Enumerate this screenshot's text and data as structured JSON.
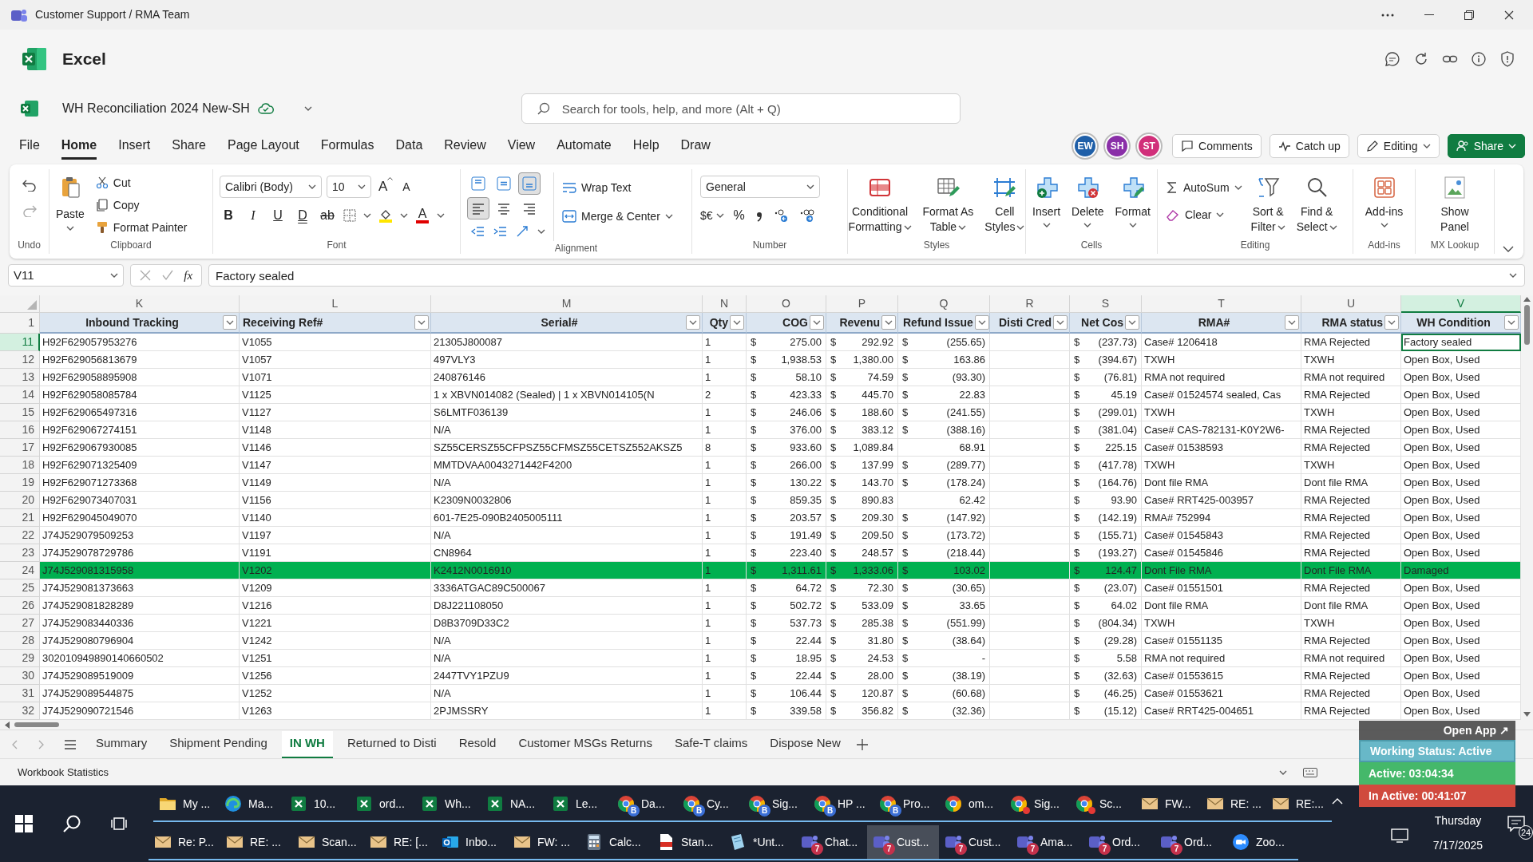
{
  "window": {
    "title": "Customer Support / RMA Team"
  },
  "app": {
    "name": "Excel"
  },
  "document": {
    "name": "WH Reconciliation 2024 New-SH"
  },
  "search": {
    "placeholder": "Search for tools, help, and more (Alt + Q)"
  },
  "tabs": [
    {
      "label": "File",
      "selected": false
    },
    {
      "label": "Home",
      "selected": true
    },
    {
      "label": "Insert",
      "selected": false
    },
    {
      "label": "Share",
      "selected": false
    },
    {
      "label": "Page Layout",
      "selected": false
    },
    {
      "label": "Formulas",
      "selected": false
    },
    {
      "label": "Data",
      "selected": false
    },
    {
      "label": "Review",
      "selected": false
    },
    {
      "label": "View",
      "selected": false
    },
    {
      "label": "Automate",
      "selected": false
    },
    {
      "label": "Help",
      "selected": false
    },
    {
      "label": "Draw",
      "selected": false
    }
  ],
  "avatars": [
    {
      "initials": "EW",
      "color": "#1f5fa8"
    },
    {
      "initials": "SH",
      "color": "#8a2fa8"
    },
    {
      "initials": "ST",
      "color": "#d12f7a"
    }
  ],
  "actions": [
    {
      "kind": "comments",
      "label": "Comments"
    },
    {
      "kind": "catchup",
      "label": "Catch up"
    },
    {
      "kind": "editing",
      "label": "Editing"
    },
    {
      "kind": "share",
      "label": "Share"
    }
  ],
  "ribbon": [
    {
      "kind": "undo",
      "label": "Undo"
    },
    {
      "kind": "clipboard",
      "label": "Clipboard",
      "paste": "Paste",
      "items": [
        "Cut",
        "Copy",
        "Format Painter"
      ]
    },
    {
      "kind": "font",
      "label": "Font",
      "font": "Calibri (Body)",
      "size": "10",
      "grow": "A",
      "shrink": "A",
      "styles": [
        "B",
        "I",
        "U",
        "D",
        "ab"
      ],
      "color_letter": "A"
    },
    {
      "kind": "alignment",
      "label": "Alignment",
      "align": [
        {
          "selected": false
        },
        {
          "selected": false
        },
        {
          "selected": true
        },
        {
          "selected": true
        },
        {
          "selected": false
        },
        {
          "selected": false
        }
      ],
      "wrap": "Wrap Text",
      "merge": "Merge & Center"
    },
    {
      "kind": "number",
      "label": "Number",
      "format": "General",
      "currency": "$€",
      "percent": "%"
    },
    {
      "kind": "large",
      "label": "Styles",
      "buttons": [
        {
          "lines": [
            "Conditional",
            "Formatting"
          ],
          "dropdown": true
        },
        {
          "lines": [
            "Format As",
            "Table"
          ],
          "dropdown": true
        },
        {
          "lines": [
            "Cell",
            "Styles"
          ],
          "dropdown": true
        }
      ]
    },
    {
      "kind": "large",
      "label": "Cells",
      "buttons": [
        {
          "lines": [
            "Insert"
          ],
          "dropdown": true
        },
        {
          "lines": [
            "Delete"
          ],
          "dropdown": true
        },
        {
          "lines": [
            "Format"
          ],
          "dropdown": true
        }
      ]
    },
    {
      "kind": "editing",
      "label": "Editing",
      "small": [
        "AutoSum",
        "Clear"
      ],
      "buttons": [
        {
          "lines": [
            "Sort &",
            "Filter"
          ],
          "dropdown": true
        },
        {
          "lines": [
            "Find &",
            "Select"
          ],
          "dropdown": true
        }
      ]
    },
    {
      "kind": "large",
      "label": "Add-ins",
      "buttons": [
        {
          "lines": [
            "Add-ins"
          ],
          "dropdown": true
        }
      ]
    },
    {
      "kind": "large",
      "label": "MX Lookup",
      "buttons": [
        {
          "lines": [
            "Show",
            "Panel"
          ],
          "dropdown": false
        }
      ]
    }
  ],
  "formula_bar": {
    "cell": "V11",
    "function_button": "fx",
    "value": "Factory sealed"
  },
  "header_row_number": "1",
  "columns": [
    {
      "letter": "K",
      "header": "Inbound Tracking",
      "kind": "text",
      "selected": false
    },
    {
      "letter": "L",
      "header": "Receiving Ref#",
      "kind": "text",
      "selected": false
    },
    {
      "letter": "M",
      "header": "Serial#",
      "kind": "text",
      "selected": false
    },
    {
      "letter": "N",
      "header": "Qty",
      "kind": "text",
      "selected": false
    },
    {
      "letter": "O",
      "header": "COG",
      "kind": "money",
      "selected": false
    },
    {
      "letter": "P",
      "header": "Revenu",
      "kind": "money",
      "selected": false
    },
    {
      "letter": "Q",
      "header": "Refund Issue",
      "kind": "money",
      "selected": false
    },
    {
      "letter": "R",
      "header": "Disti Cred",
      "kind": "blank",
      "selected": false
    },
    {
      "letter": "S",
      "header": "Net Cos",
      "kind": "money",
      "selected": false
    },
    {
      "letter": "T",
      "header": "RMA#",
      "kind": "text",
      "selected": false
    },
    {
      "letter": "U",
      "header": "RMA status",
      "kind": "text",
      "selected": false
    },
    {
      "letter": "V",
      "header": "WH Condition",
      "kind": "text",
      "selected": true
    }
  ],
  "rows": [
    {
      "number": "11",
      "active": true,
      "highlighted": false,
      "cells": [
        "H92F629057953276",
        "V1055",
        "21305J800087",
        "1",
        {
          "symbol": "$",
          "amount": "275.00"
        },
        {
          "symbol": "$",
          "amount": "292.92"
        },
        {
          "symbol": "$",
          "amount": "(255.65)"
        },
        {
          "symbol": "$",
          "amount": "(237.73)"
        },
        "Case# 1206418",
        "RMA Rejected",
        "Factory sealed"
      ]
    },
    {
      "number": "12",
      "active": false,
      "highlighted": false,
      "cells": [
        "H92F629056813679",
        "V1057",
        "497VLY3",
        "1",
        {
          "symbol": "$",
          "amount": "1,938.53"
        },
        {
          "symbol": "$",
          "amount": "1,380.00"
        },
        {
          "symbol": "$",
          "amount": "163.86"
        },
        {
          "symbol": "$",
          "amount": "(394.67)"
        },
        "TXWH",
        "TXWH",
        "Open Box, Used"
      ]
    },
    {
      "number": "13",
      "active": false,
      "highlighted": false,
      "cells": [
        "H92F629058895908",
        "V1071",
        "240876146",
        "1",
        {
          "symbol": "$",
          "amount": "58.10"
        },
        {
          "symbol": "$",
          "amount": "74.59"
        },
        {
          "symbol": "$",
          "amount": "(93.30)"
        },
        {
          "symbol": "$",
          "amount": "(76.81)"
        },
        "RMA not required",
        "RMA not required",
        "Open Box, Used"
      ]
    },
    {
      "number": "14",
      "active": false,
      "highlighted": false,
      "cells": [
        "H92F629058085784",
        "V1125",
        "1 x XBVN014082 (Sealed) | 1 x XBVN014105(N",
        "2",
        {
          "symbol": "$",
          "amount": "423.33"
        },
        {
          "symbol": "$",
          "amount": "445.70"
        },
        {
          "symbol": "$",
          "amount": "22.83"
        },
        {
          "symbol": "$",
          "amount": "45.19"
        },
        "Case# 01524574 sealed, Cas",
        "RMA Rejected",
        "Open Box, Used"
      ]
    },
    {
      "number": "15",
      "active": false,
      "highlighted": false,
      "cells": [
        "H92F629065497316",
        "V1127",
        "S6LMTF036139",
        "1",
        {
          "symbol": "$",
          "amount": "246.06"
        },
        {
          "symbol": "$",
          "amount": "188.60"
        },
        {
          "symbol": "$",
          "amount": "(241.55)"
        },
        {
          "symbol": "$",
          "amount": "(299.01)"
        },
        "TXWH",
        "TXWH",
        "Open Box, Used"
      ]
    },
    {
      "number": "16",
      "active": false,
      "highlighted": false,
      "cells": [
        "H92F629067274151",
        "V1148",
        "N/A",
        "1",
        {
          "symbol": "$",
          "amount": "376.00"
        },
        {
          "symbol": "$",
          "amount": "383.12"
        },
        {
          "symbol": "$",
          "amount": "(388.16)"
        },
        {
          "symbol": "$",
          "amount": "(381.04)"
        },
        "Case# CAS-782131-K0Y2W6-",
        "RMA Rejected",
        "Open Box, Used"
      ]
    },
    {
      "number": "17",
      "active": false,
      "highlighted": false,
      "cells": [
        "H92F629067930085",
        "V1146",
        "SZ55CERSZ55CFPSZ55CFMSZ55CETSZ552AKSZ5",
        "8",
        {
          "symbol": "$",
          "amount": "933.60"
        },
        {
          "symbol": "$",
          "amount": "1,089.84"
        },
        {
          "amount": "68.91"
        },
        {
          "symbol": "$",
          "amount": "225.15"
        },
        "Case# 01538593",
        "RMA Rejected",
        "Open Box, Used"
      ]
    },
    {
      "number": "18",
      "active": false,
      "highlighted": false,
      "cells": [
        "H92F629071325409",
        "V1147",
        "MMTDVAA0043271442F4200",
        "1",
        {
          "symbol": "$",
          "amount": "266.00"
        },
        {
          "symbol": "$",
          "amount": "137.99"
        },
        {
          "symbol": "$",
          "amount": "(289.77)"
        },
        {
          "symbol": "$",
          "amount": "(417.78)"
        },
        "TXWH",
        "TXWH",
        "Open Box, Used"
      ]
    },
    {
      "number": "19",
      "active": false,
      "highlighted": false,
      "cells": [
        "H92F629071273368",
        "V1149",
        "N/A",
        "1",
        {
          "symbol": "$",
          "amount": "130.22"
        },
        {
          "symbol": "$",
          "amount": "143.70"
        },
        {
          "symbol": "$",
          "amount": "(178.24)"
        },
        {
          "symbol": "$",
          "amount": "(164.76)"
        },
        "Dont file RMA",
        "Dont file RMA",
        "Open Box, Used"
      ]
    },
    {
      "number": "20",
      "active": false,
      "highlighted": false,
      "cells": [
        "H92F629073407031",
        "V1156",
        "K2309N0032806",
        "1",
        {
          "symbol": "$",
          "amount": "859.35"
        },
        {
          "symbol": "$",
          "amount": "890.83"
        },
        {
          "amount": "62.42"
        },
        {
          "symbol": "$",
          "amount": "93.90"
        },
        "Case# RRT425-003957",
        "RMA Rejected",
        "Open Box, Used"
      ]
    },
    {
      "number": "21",
      "active": false,
      "highlighted": false,
      "cells": [
        "H92F629045049070",
        "V1140",
        "601-7E25-090B2405005111",
        "1",
        {
          "symbol": "$",
          "amount": "203.57"
        },
        {
          "symbol": "$",
          "amount": "209.30"
        },
        {
          "symbol": "$",
          "amount": "(147.92)"
        },
        {
          "symbol": "$",
          "amount": "(142.19)"
        },
        "RMA# 752994",
        "RMA Rejected",
        "Open Box, Used"
      ]
    },
    {
      "number": "22",
      "active": false,
      "highlighted": false,
      "cells": [
        "J74J529079509253",
        "V1197",
        "N/A",
        "1",
        {
          "symbol": "$",
          "amount": "191.49"
        },
        {
          "symbol": "$",
          "amount": "209.50"
        },
        {
          "symbol": "$",
          "amount": "(173.72)"
        },
        {
          "symbol": "$",
          "amount": "(155.71)"
        },
        "Case# 01545843",
        "RMA Rejected",
        "Open Box, Used"
      ]
    },
    {
      "number": "23",
      "active": false,
      "highlighted": false,
      "cells": [
        "J74J529078729786",
        "V1191",
        "CN8964",
        "1",
        {
          "symbol": "$",
          "amount": "223.40"
        },
        {
          "symbol": "$",
          "amount": "248.57"
        },
        {
          "symbol": "$",
          "amount": "(218.44)"
        },
        {
          "symbol": "$",
          "amount": "(193.27)"
        },
        "Case# 01545846",
        "RMA Rejected",
        "Open Box, Used"
      ]
    },
    {
      "number": "24",
      "active": false,
      "highlighted": true,
      "cells": [
        "J74J529081315958",
        "V1202",
        "K2412N0016910",
        "1",
        {
          "symbol": "$",
          "amount": "1,311.61"
        },
        {
          "symbol": "$",
          "amount": "1,333.06"
        },
        {
          "symbol": "$",
          "amount": "103.02"
        },
        {
          "symbol": "$",
          "amount": "124.47"
        },
        "Dont File RMA",
        "Dont File RMA",
        "Damaged"
      ]
    },
    {
      "number": "25",
      "active": false,
      "highlighted": false,
      "cells": [
        "J74J529081373663",
        "V1209",
        "3336ATGAC89C500067",
        "1",
        {
          "symbol": "$",
          "amount": "64.72"
        },
        {
          "symbol": "$",
          "amount": "72.30"
        },
        {
          "symbol": "$",
          "amount": "(30.65)"
        },
        {
          "symbol": "$",
          "amount": "(23.07)"
        },
        "Case# 01551501",
        "RMA Rejected",
        "Open Box, Used"
      ]
    },
    {
      "number": "26",
      "active": false,
      "highlighted": false,
      "cells": [
        "J74J529081828289",
        "V1216",
        "D8J221108050",
        "1",
        {
          "symbol": "$",
          "amount": "502.72"
        },
        {
          "symbol": "$",
          "amount": "533.09"
        },
        {
          "symbol": "$",
          "amount": "33.65"
        },
        {
          "symbol": "$",
          "amount": "64.02"
        },
        "Dont file RMA",
        "Dont file RMA",
        "Open Box, Used"
      ]
    },
    {
      "number": "27",
      "active": false,
      "highlighted": false,
      "cells": [
        "J74J529083440336",
        "V1221",
        "D8B3709D33C2",
        "1",
        {
          "symbol": "$",
          "amount": "537.73"
        },
        {
          "symbol": "$",
          "amount": "285.38"
        },
        {
          "symbol": "$",
          "amount": "(551.99)"
        },
        {
          "symbol": "$",
          "amount": "(804.34)"
        },
        "TXWH",
        "TXWH",
        "Open Box, Used"
      ]
    },
    {
      "number": "28",
      "active": false,
      "highlighted": false,
      "cells": [
        "J74J529080796904",
        "V1242",
        "N/A",
        "1",
        {
          "symbol": "$",
          "amount": "22.44"
        },
        {
          "symbol": "$",
          "amount": "31.80"
        },
        {
          "symbol": "$",
          "amount": "(38.64)"
        },
        {
          "symbol": "$",
          "amount": "(29.28)"
        },
        "Case# 01551135",
        "RMA Rejected",
        "Open Box, Used"
      ]
    },
    {
      "number": "29",
      "active": false,
      "highlighted": false,
      "cells": [
        "302010949890140660502",
        "V1251",
        "N/A",
        "1",
        {
          "symbol": "$",
          "amount": "18.95"
        },
        {
          "symbol": "$",
          "amount": "24.53"
        },
        {
          "symbol": "$",
          "amount": "-"
        },
        {
          "symbol": "$",
          "amount": "5.58"
        },
        "RMA not required",
        "RMA not required",
        "Open Box, Used"
      ]
    },
    {
      "number": "30",
      "active": false,
      "highlighted": false,
      "cells": [
        "J74J529089519009",
        "V1256",
        "2447TVY1PZU9",
        "1",
        {
          "symbol": "$",
          "amount": "22.44"
        },
        {
          "symbol": "$",
          "amount": "28.00"
        },
        {
          "symbol": "$",
          "amount": "(38.19)"
        },
        {
          "symbol": "$",
          "amount": "(32.63)"
        },
        "Case# 01553615",
        "RMA Rejected",
        "Open Box, Used"
      ]
    },
    {
      "number": "31",
      "active": false,
      "highlighted": false,
      "cells": [
        "J74J529089544875",
        "V1252",
        "N/A",
        "1",
        {
          "symbol": "$",
          "amount": "106.44"
        },
        {
          "symbol": "$",
          "amount": "120.87"
        },
        {
          "symbol": "$",
          "amount": "(60.68)"
        },
        {
          "symbol": "$",
          "amount": "(46.25)"
        },
        "Case# 01553621",
        "RMA Rejected",
        "Open Box, Used"
      ]
    },
    {
      "number": "32",
      "active": false,
      "highlighted": false,
      "cells": [
        "J74J529090721546",
        "V1263",
        "2PJMSSRY",
        "1",
        {
          "symbol": "$",
          "amount": "339.58"
        },
        {
          "symbol": "$",
          "amount": "356.82"
        },
        {
          "symbol": "$",
          "amount": "(32.36)"
        },
        {
          "symbol": "$",
          "amount": "(15.12)"
        },
        "Case# RRT425-004651",
        "RMA Rejected",
        "Open Box, Used"
      ]
    }
  ],
  "sheets": [
    {
      "label": "Summary",
      "selected": false
    },
    {
      "label": "Shipment Pending",
      "selected": false
    },
    {
      "label": "IN WH",
      "selected": true
    },
    {
      "label": "Returned to Disti",
      "selected": false
    },
    {
      "label": "Resold",
      "selected": false
    },
    {
      "label": "Customer MSGs Returns",
      "selected": false
    },
    {
      "label": "Safe-T claims",
      "selected": false
    },
    {
      "label": "Dispose New",
      "selected": false
    }
  ],
  "status_bar": {
    "text": "Workbook Statistics"
  },
  "taskbar": {
    "top_row": [
      {
        "kind": "folder",
        "label": "My ...",
        "selected": false
      },
      {
        "kind": "edge",
        "label": "Ma...",
        "selected": false
      },
      {
        "kind": "excel",
        "label": "10...",
        "selected": false
      },
      {
        "kind": "excel",
        "label": "ord...",
        "selected": false
      },
      {
        "kind": "excel",
        "label": "Wh...",
        "selected": false
      },
      {
        "kind": "excel",
        "label": "NA...",
        "selected": false
      },
      {
        "kind": "excel",
        "label": "Le...",
        "selected": false
      },
      {
        "kind": "chrome",
        "label": "Da...",
        "selected": false,
        "badge": "B",
        "notification": false
      },
      {
        "kind": "chrome",
        "label": "Cy...",
        "selected": false,
        "badge": "B",
        "notification": false
      },
      {
        "kind": "chrome",
        "label": "Sig...",
        "selected": false,
        "badge": "B",
        "notification": false
      },
      {
        "kind": "chrome",
        "label": "HP ...",
        "selected": false,
        "badge": "B",
        "notification": false
      },
      {
        "kind": "chrome",
        "label": "Pro...",
        "selected": false,
        "badge": "B",
        "notification": false
      },
      {
        "kind": "chrome",
        "label": "om...",
        "selected": false,
        "notification": false
      },
      {
        "kind": "chrome",
        "label": "Sig...",
        "selected": false,
        "notification": true
      },
      {
        "kind": "chrome",
        "label": "Sc...",
        "selected": false,
        "notification": true
      },
      {
        "kind": "mail",
        "label": "FW...",
        "selected": false
      },
      {
        "kind": "mail",
        "label": "RE: ...",
        "selected": false
      },
      {
        "kind": "mail",
        "label": "RE:...",
        "selected": false
      }
    ],
    "bottom_row": [
      {
        "kind": "mail",
        "label": "Re: P...",
        "selected": false
      },
      {
        "kind": "mail",
        "label": "RE: ...",
        "selected": false
      },
      {
        "kind": "mail",
        "label": "Scan...",
        "selected": false
      },
      {
        "kind": "mail",
        "label": "RE: [...",
        "selected": false
      },
      {
        "kind": "outlook",
        "label": "Inbo...",
        "selected": false
      },
      {
        "kind": "mail",
        "label": "FW: ...",
        "selected": false
      },
      {
        "kind": "calculator",
        "label": "Calc...",
        "selected": false
      },
      {
        "kind": "pdf",
        "label": "Stan...",
        "selected": false
      },
      {
        "kind": "notepad",
        "label": "*Unt...",
        "selected": false
      },
      {
        "kind": "teams",
        "label": "Chat...",
        "selected": false,
        "badge": "7"
      },
      {
        "kind": "teams",
        "label": "Cust...",
        "selected": true,
        "badge": "7"
      },
      {
        "kind": "teams",
        "label": "Cust...",
        "selected": false,
        "badge": "7"
      },
      {
        "kind": "teams",
        "label": "Ama...",
        "selected": false,
        "badge": "7"
      },
      {
        "kind": "teams",
        "label": "Ord...",
        "selected": false,
        "badge": "7"
      },
      {
        "kind": "teams",
        "label": "Ord...",
        "selected": false,
        "badge": "7"
      },
      {
        "kind": "zoom",
        "label": "Zoo...",
        "selected": false
      }
    ],
    "day": "Thursday",
    "date": "7/17/2025",
    "notifications": "24"
  },
  "overlay": {
    "button": "Open App ↗",
    "status": "Working Status: Active",
    "active": "Active: 03:04:34",
    "inactive": "In Active: 00:41:07"
  }
}
